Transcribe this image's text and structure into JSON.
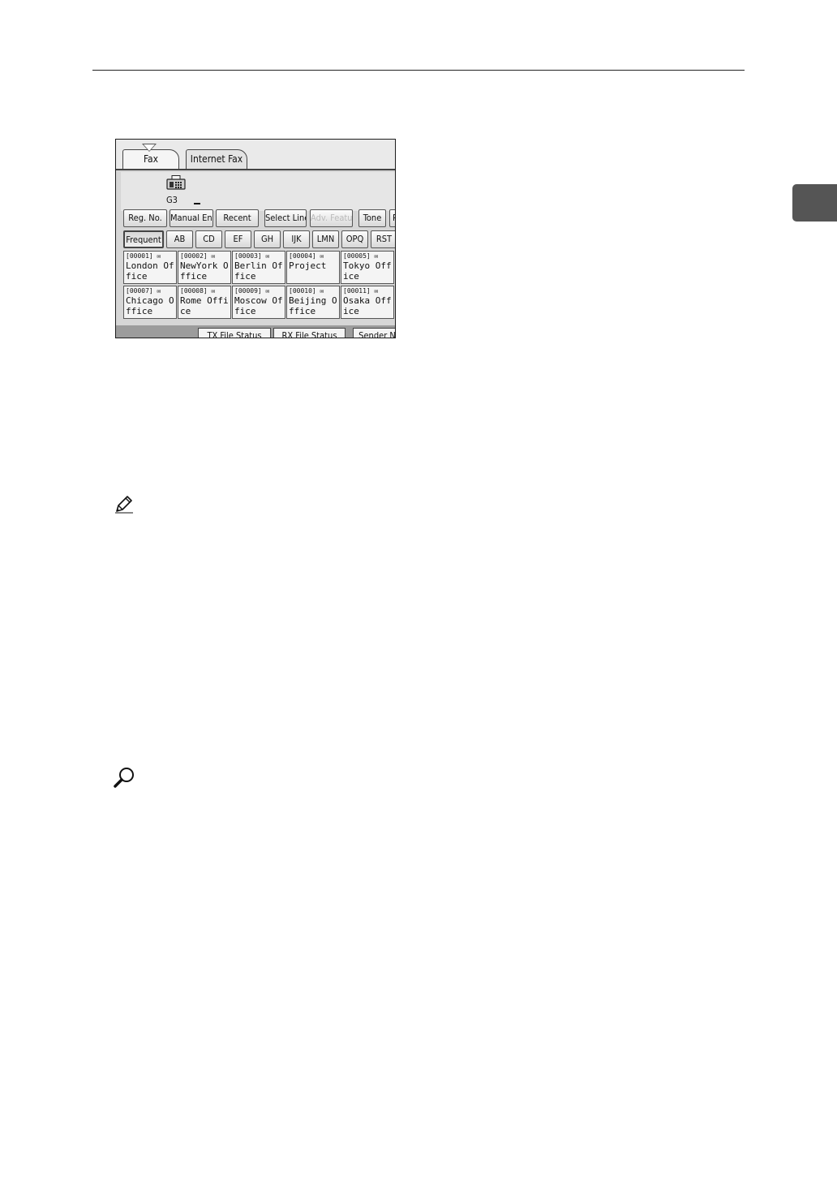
{
  "screen": {
    "tabs": [
      "Fax",
      "Internet Fax"
    ],
    "line_label": "G3",
    "toolbar": [
      "Reg. No.",
      "Manual Entry",
      "Recent",
      "Select Line",
      "Adv. Features",
      "Tone",
      "P"
    ],
    "index_tabs": [
      "Frequent",
      "AB",
      "CD",
      "EF",
      "GH",
      "IJK",
      "LMN",
      "OPQ",
      "RST"
    ],
    "entries": [
      {
        "code": "[00001]",
        "name": "London Office"
      },
      {
        "code": "[00002]",
        "name": "NewYork Office"
      },
      {
        "code": "[00003]",
        "name": "Berlin Office"
      },
      {
        "code": "[00004]",
        "name": "Project"
      },
      {
        "code": "[00005]",
        "name": "Tokyo Office"
      },
      {
        "code": "[00007]",
        "name": "Chicago Office"
      },
      {
        "code": "[00008]",
        "name": "Rome Office"
      },
      {
        "code": "[00009]",
        "name": "Moscow Office"
      },
      {
        "code": "[00010]",
        "name": "Beijing Office"
      },
      {
        "code": "[00011]",
        "name": "Osaka Office"
      }
    ],
    "status_buttons": [
      "TX File Status",
      "RX File Status",
      "Sender N"
    ]
  },
  "icons": {
    "fax": "fax-machine-icon",
    "mail": "mail-icon",
    "note": "pencil-note-icon",
    "reference": "magnifier-reference-icon"
  }
}
